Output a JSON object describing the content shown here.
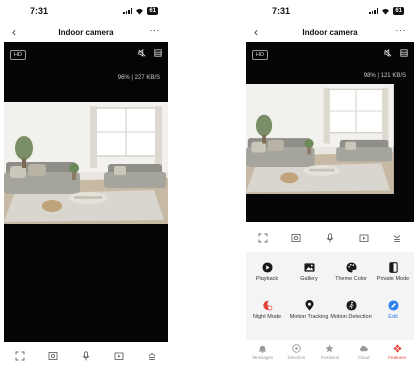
{
  "status": {
    "time": "7:31",
    "battery": "61"
  },
  "header": {
    "title": "Indoor camera",
    "more_glyph": "···"
  },
  "video": {
    "quality": "HD"
  },
  "left_screen": {
    "stats": "96% | 227 KB/S"
  },
  "right_screen": {
    "stats": "98% | 121 KB/S",
    "features": [
      {
        "label": "Playback",
        "icon": "play-icon",
        "active": false
      },
      {
        "label": "Gallery",
        "icon": "image-icon",
        "active": false
      },
      {
        "label": "Theme Color",
        "icon": "palette-icon",
        "active": false
      },
      {
        "label": "Private Mode",
        "icon": "private-mode-icon",
        "active": false
      },
      {
        "label": "Night Mode",
        "icon": "night-mode-icon",
        "active": true
      },
      {
        "label": "Motion Tracking",
        "icon": "location-pin-icon",
        "active": false
      },
      {
        "label": "Motion Detection",
        "icon": "motion-detection-icon",
        "active": false
      },
      {
        "label": "Edit",
        "icon": "pencil-icon",
        "active": false
      }
    ],
    "tabs": [
      {
        "label": "Messages",
        "icon": "bell-icon",
        "active": false
      },
      {
        "label": "Direction",
        "icon": "joystick-icon",
        "active": false
      },
      {
        "label": "Positions",
        "icon": "star-icon",
        "active": false
      },
      {
        "label": "Cloud",
        "icon": "cloud-icon",
        "active": false
      },
      {
        "label": "Features",
        "icon": "features-icon",
        "active": true
      }
    ]
  },
  "colors": {
    "accent": "#e8413a",
    "edit_blue": "#2f80ed",
    "video_bg": "#050505"
  }
}
